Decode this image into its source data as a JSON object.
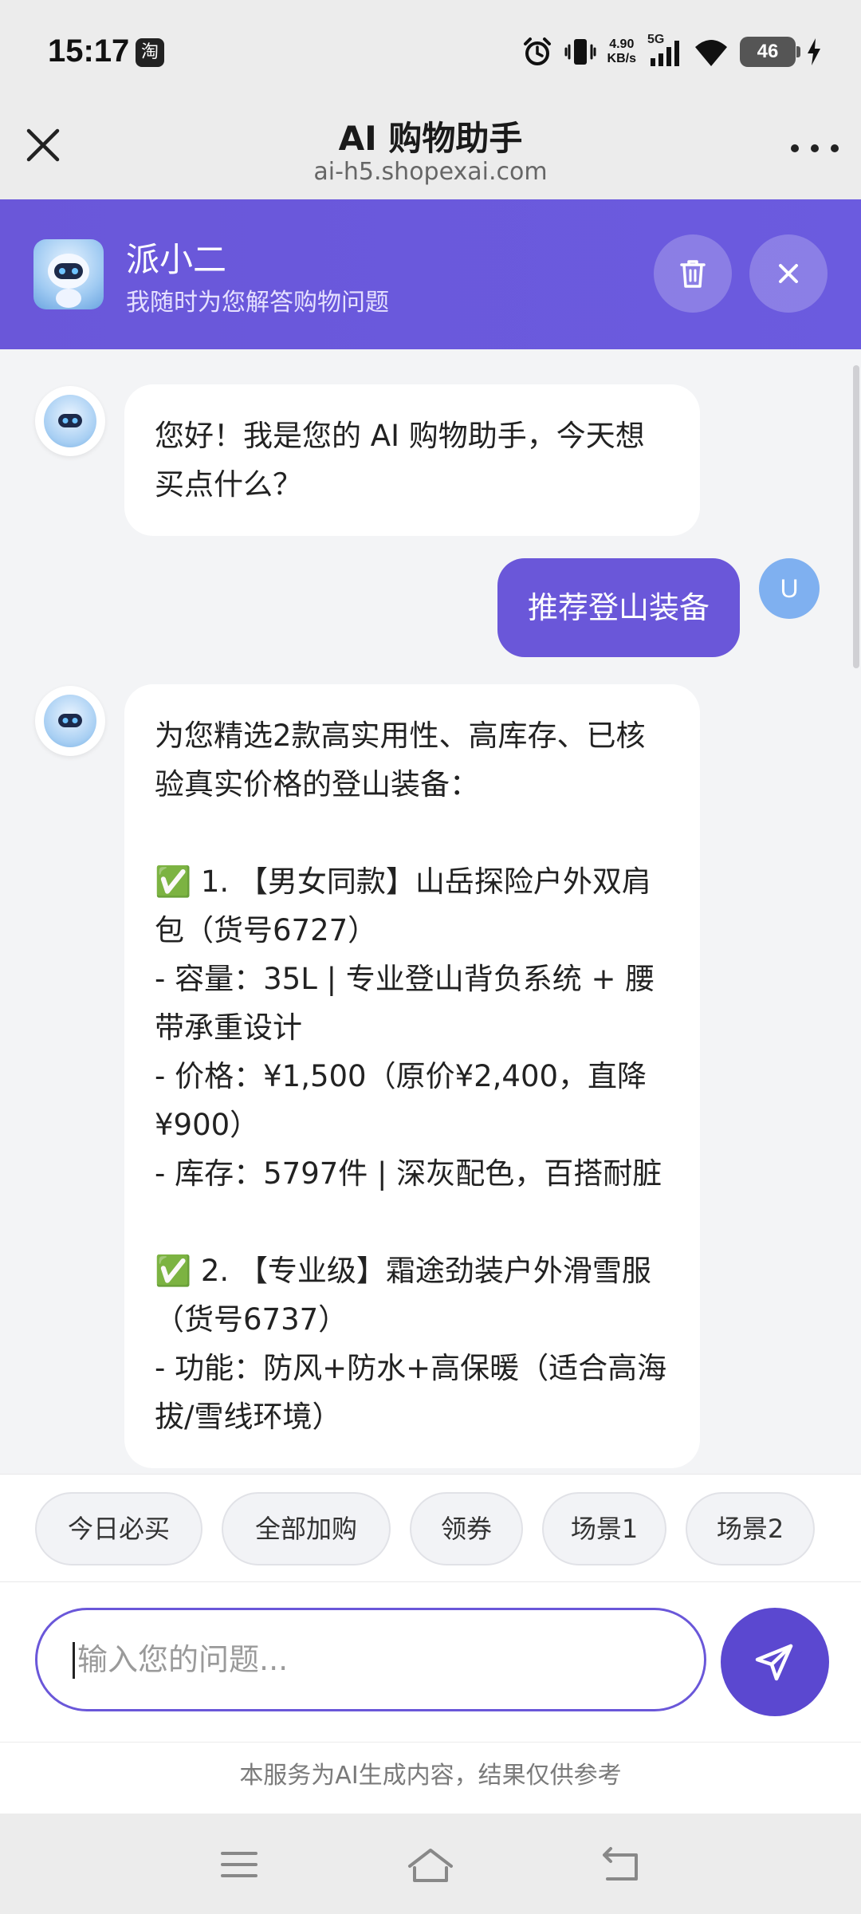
{
  "status_bar": {
    "time": "15:17",
    "app_badge": "淘",
    "net_speed_value": "4.90",
    "net_speed_unit": "KB/s",
    "network": "5G",
    "battery": "46"
  },
  "browser": {
    "title": "AI 购物助手",
    "url": "ai-h5.shopexai.com"
  },
  "assistant": {
    "name": "派小二",
    "subtitle": "我随时为您解答购物问题"
  },
  "messages": {
    "greeting": "您好！我是您的 AI 购物助手，今天想买点什么？",
    "user_query": "推荐登山装备",
    "user_avatar": "U",
    "reply": "为您精选2款高实用性、高库存、已核验真实价格的登山装备：\n\n✅ 1. 【男女同款】山岳探险户外双肩包（货号6727）\n- 容量：35L | 专业登山背负系统 + 腰带承重设计\n- 价格：¥1,500（原价¥2,400，直降¥900）\n- 库存：5797件 | 深灰配色，百搭耐脏\n\n✅ 2. 【专业级】霜途劲装户外滑雪服（货号6737）\n- 功能：防风+防水+高保暖（适合高海拔/雪线环境）"
  },
  "quick_actions": [
    "今日必买",
    "全部加购",
    "领券",
    "场景1",
    "场景2"
  ],
  "input": {
    "placeholder": "输入您的问题..."
  },
  "disclaimer": "本服务为AI生成内容，结果仅供参考",
  "colors": {
    "accent": "#6a57d9",
    "send_button": "#5b48d0",
    "user_avatar": "#7fb0f0"
  }
}
